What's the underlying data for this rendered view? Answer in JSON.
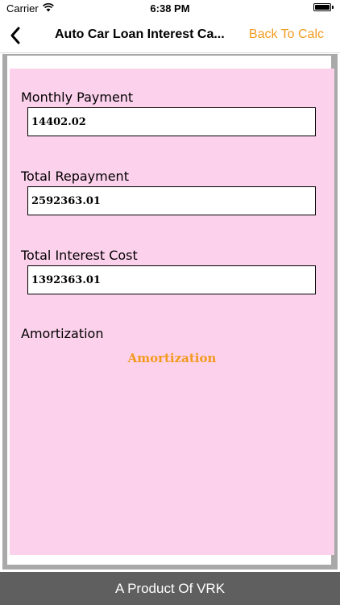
{
  "status_bar": {
    "carrier": "Carrier",
    "time": "6:38 PM",
    "icons": [
      "wifi-icon",
      "battery-icon"
    ]
  },
  "nav": {
    "back_icon": "chevron-left-icon",
    "title": "Auto Car Loan Interest Ca...",
    "back_to_calc": "Back To Calc"
  },
  "results": {
    "monthly_payment_label": "Monthly Payment",
    "monthly_payment_value": "14402.02",
    "total_repayment_label": "Total Repayment",
    "total_repayment_value": "2592363.01",
    "total_interest_label": "Total Interest Cost",
    "total_interest_value": "1392363.01",
    "amortization_label": "Amortization",
    "amortization_link": "Amortization"
  },
  "footer": {
    "text": "A Product Of VRK"
  },
  "colors": {
    "accent": "#f39a1e",
    "pink_panel": "#fcd1ec",
    "footer_bg": "#5f5f5f"
  }
}
